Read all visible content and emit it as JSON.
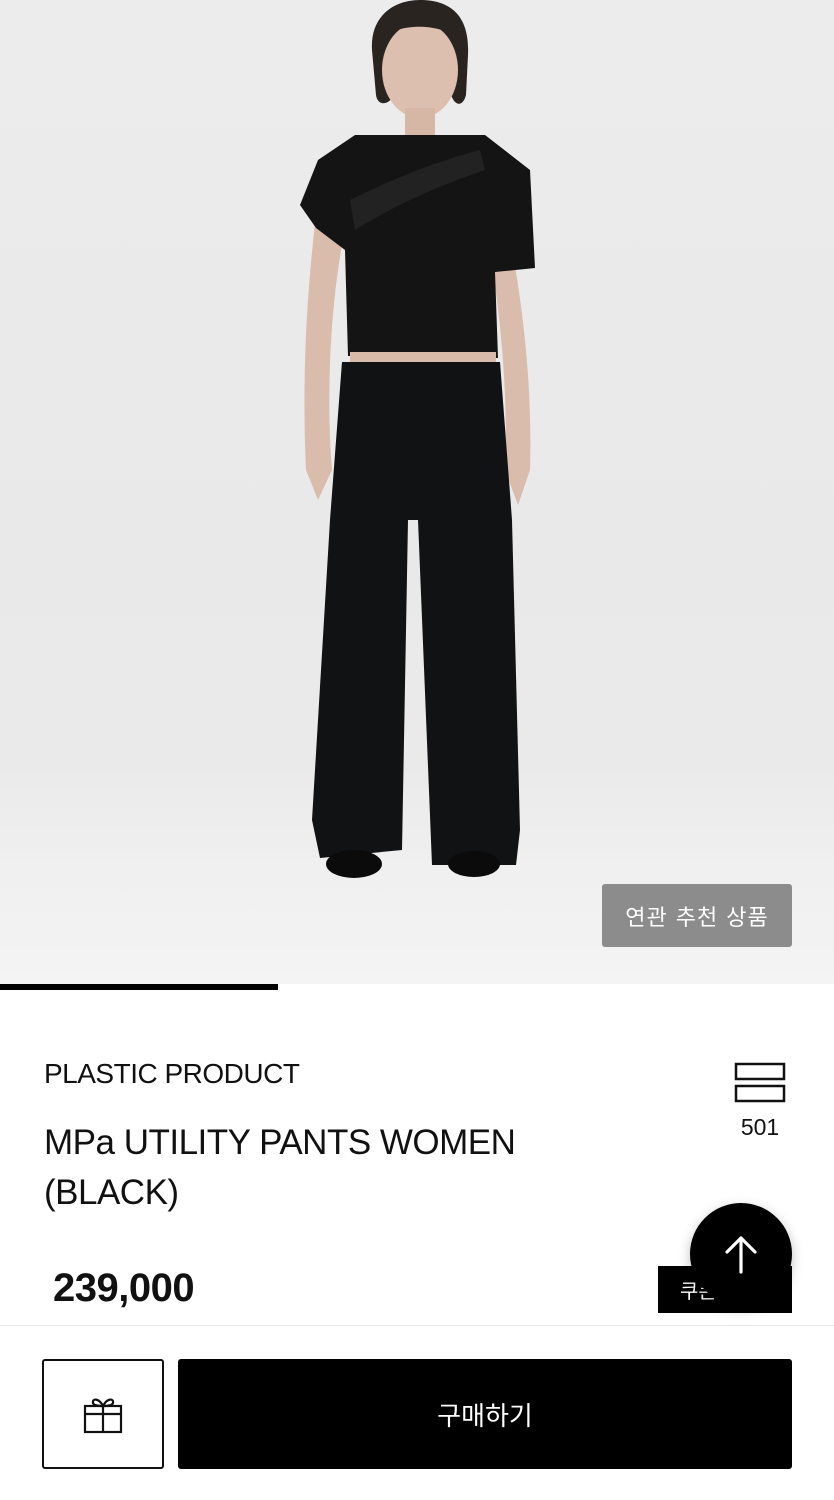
{
  "hero": {
    "related_button_label": "연관 추천 상품",
    "slide_progress": 0.333
  },
  "product": {
    "brand": "PLASTIC PRODUCT",
    "name": "MPa UTILITY PANTS WOMEN (BLACK)",
    "price": "239,000",
    "wish_count": "501"
  },
  "actions": {
    "coupon_label": "쿠폰",
    "buy_label": "구매하기",
    "scroll_top_icon": "arrow-up-icon",
    "gift_icon": "gift-icon",
    "wish_icon": "wishlist-icon"
  },
  "colors": {
    "primary_button": "#000000",
    "related_button": "#8c8c8c"
  }
}
